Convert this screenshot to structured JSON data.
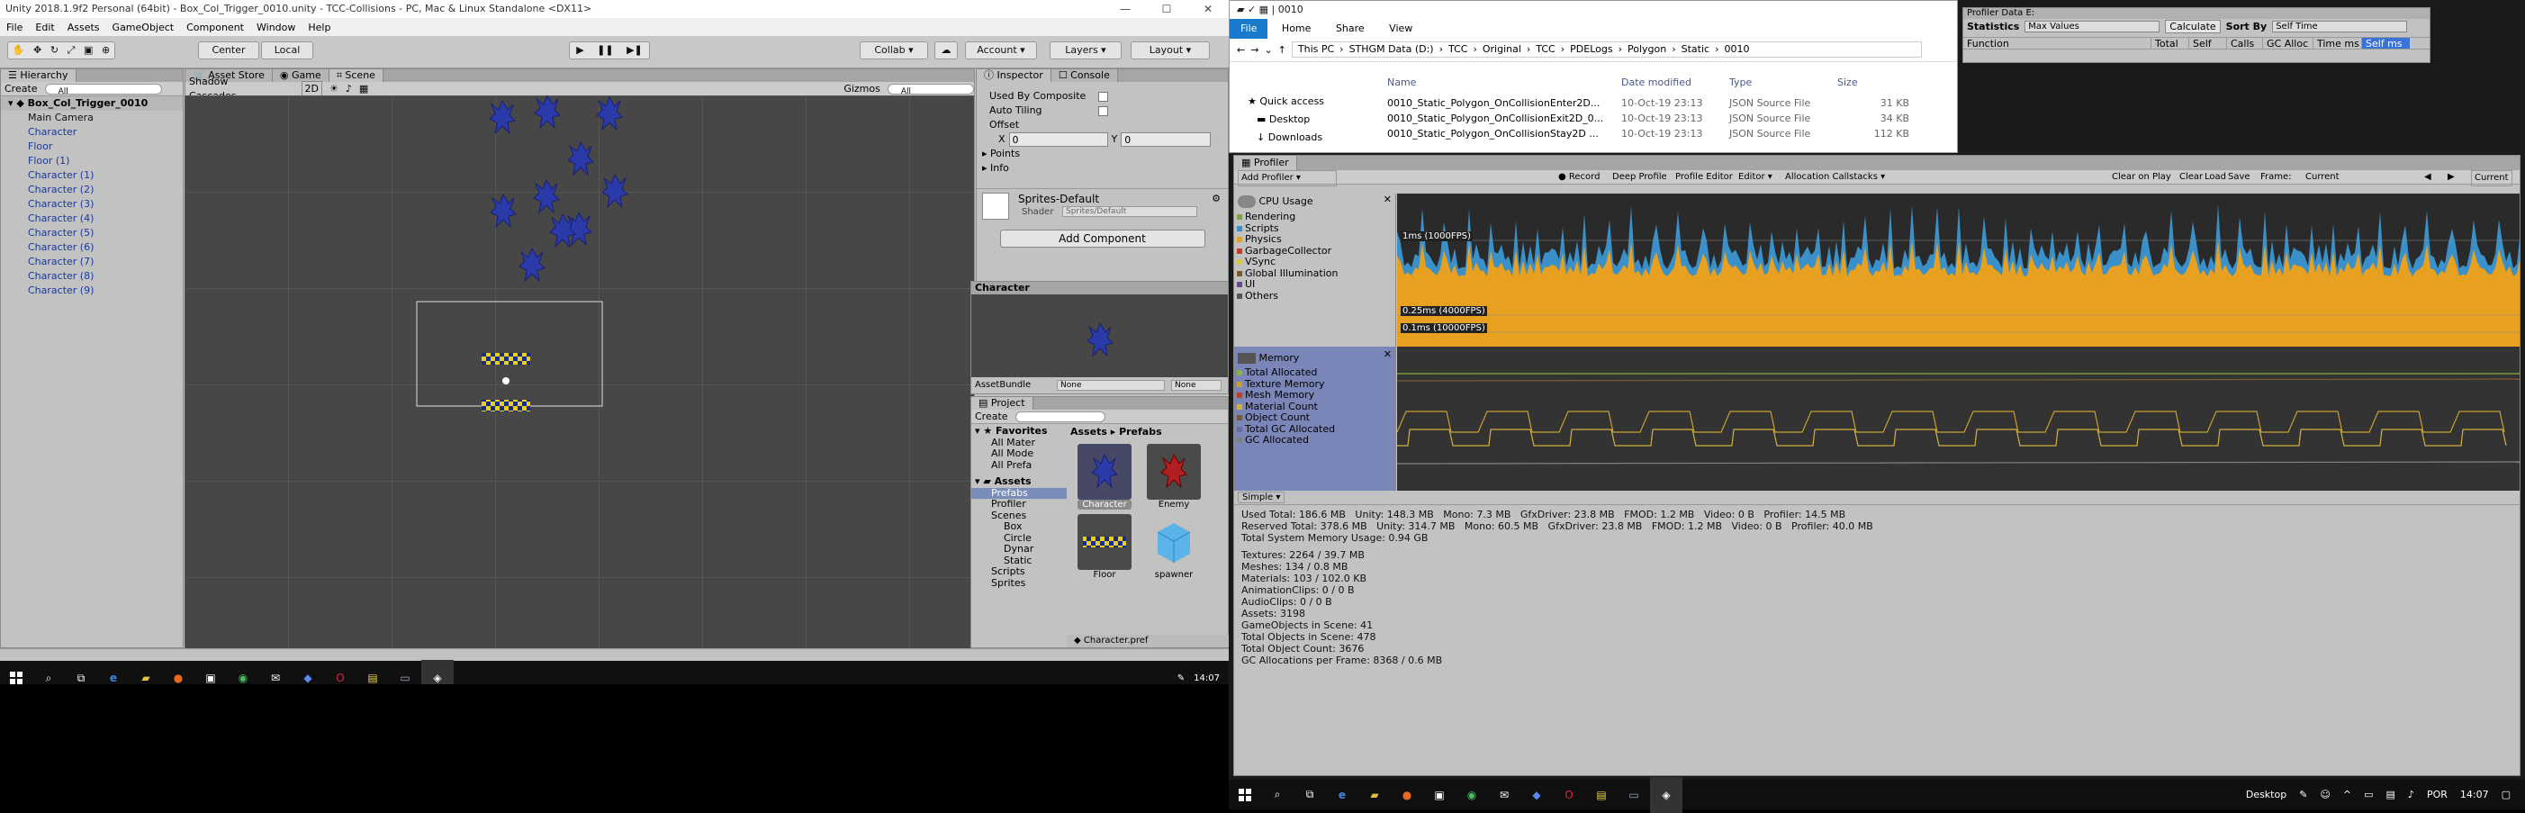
{
  "unity": {
    "title": "Unity 2018.1.9f2 Personal (64bit) - Box_Col_Trigger_0010.unity - TCC-Collisions - PC, Mac & Linux Standalone <DX11>",
    "menu": [
      "File",
      "Edit",
      "Assets",
      "GameObject",
      "Component",
      "Window",
      "Help"
    ],
    "toolbar": {
      "center": "Center",
      "local": "Local",
      "collab": "Collab",
      "account": "Account",
      "layers": "Layers",
      "layout": "Layout"
    },
    "hierarchy": {
      "tab": "Hierarchy",
      "create": "Create",
      "search_placeholder": "All",
      "root": "Box_Col_Trigger_0010",
      "items": [
        "Main Camera",
        "Character",
        "Floor",
        "Floor (1)",
        "Character (1)",
        "Character (2)",
        "Character (3)",
        "Character (4)",
        "Character (5)",
        "Character (6)",
        "Character (7)",
        "Character (8)",
        "Character (9)"
      ]
    },
    "scene": {
      "tabs": [
        "Asset Store",
        "Game",
        "Scene"
      ],
      "shading": "Shadow Cascades",
      "mode2d": "2D",
      "gizmos": "Gizmos",
      "search_placeholder": "All"
    },
    "inspector": {
      "tabs": [
        "Inspector",
        "Console"
      ],
      "used_by_composite": "Used By Composite",
      "auto_tiling": "Auto Tiling",
      "offset": "Offset",
      "x_label": "X",
      "x_val": "0",
      "y_label": "Y",
      "y_val": "0",
      "points": "Points",
      "info": "Info",
      "material": "Sprites-Default",
      "shader_label": "Shader",
      "shader_val": "Sprites/Default",
      "add_component": "Add Component",
      "preview_title": "Character",
      "asset_bundle": "AssetBundle",
      "none1": "None",
      "none2": "None"
    },
    "project": {
      "tab": "Project",
      "create": "Create",
      "favorites": "Favorites",
      "fav_items": [
        "All Mater",
        "All Mode",
        "All Prefa"
      ],
      "assets": "Assets",
      "tree": [
        "Prefabs",
        "Profiler",
        "Scenes",
        "Box",
        "Circle",
        "Dynar",
        "Static",
        "Scripts",
        "Sprites"
      ],
      "breadcrumb": [
        "Assets",
        "Prefabs"
      ],
      "grid": [
        "Character",
        "Enemy",
        "Floor",
        "spawner"
      ],
      "footer": "Character.pref"
    }
  },
  "taskbar_left": {
    "time": "14:07"
  },
  "explorer": {
    "title": "0010",
    "ribbon": [
      "File",
      "Home",
      "Share",
      "View"
    ],
    "path": [
      "This PC",
      "STHGM Data (D:)",
      "TCC",
      "Original",
      "TCC",
      "PDELogs",
      "Polygon",
      "Static",
      "0010"
    ],
    "nav": [
      "Quick access",
      "Desktop",
      "Downloads"
    ],
    "cols": [
      "Name",
      "Date modified",
      "Type",
      "Size"
    ],
    "files": [
      {
        "name": "0010_Static_Polygon_OnCollisionEnter2D...",
        "date": "10-Oct-19 23:13",
        "type": "JSON Source File",
        "size": "31 KB"
      },
      {
        "name": "0010_Static_Polygon_OnCollisionExit2D_0...",
        "date": "10-Oct-19 23:13",
        "type": "JSON Source File",
        "size": "34 KB"
      },
      {
        "name": "0010_Static_Polygon_OnCollisionStay2D ...",
        "date": "10-Oct-19 23:13",
        "type": "JSON Source File",
        "size": "112 KB"
      }
    ]
  },
  "profdata": {
    "title": "Profiler Data E:",
    "statistics": "Statistics",
    "max_values": "Max Values",
    "calculate": "Calculate",
    "sort_by": "Sort By",
    "self_time": "Self Time",
    "cols": [
      "Function",
      "Total",
      "Self",
      "Calls",
      "GC Alloc",
      "Time ms",
      "Self ms"
    ]
  },
  "profiler": {
    "tab": "Profiler",
    "add_profiler": "Add Profiler",
    "toolbar": [
      "Record",
      "Deep Profile",
      "Profile Editor",
      "Editor",
      "Allocation Callstacks"
    ],
    "toolbar_right": [
      "Clear on Play",
      "Clear",
      "Load",
      "Save",
      "Frame:",
      "Current",
      "Current"
    ],
    "cpu_title": "CPU Usage",
    "cpu_legend": [
      {
        "name": "Rendering",
        "color": "#7fa342"
      },
      {
        "name": "Scripts",
        "color": "#3a90c8"
      },
      {
        "name": "Physics",
        "color": "#e8a020"
      },
      {
        "name": "GarbageCollector",
        "color": "#c0402a"
      },
      {
        "name": "VSync",
        "color": "#d8c63c"
      },
      {
        "name": "Global Illumination",
        "color": "#7a5a2a"
      },
      {
        "name": "UI",
        "color": "#6a4a8a"
      },
      {
        "name": "Others",
        "color": "#555555"
      }
    ],
    "labels": {
      "ms1": "1ms (1000FPS)",
      "ms025": "0.25ms (4000FPS)",
      "ms01": "0.1ms (10000FPS)"
    },
    "mem_title": "Memory",
    "mem_legend": [
      {
        "name": "Total Allocated",
        "color": "#8bb040"
      },
      {
        "name": "Texture Memory",
        "color": "#c8a030"
      },
      {
        "name": "Mesh Memory",
        "color": "#c04020"
      },
      {
        "name": "Material Count",
        "color": "#d2b040"
      },
      {
        "name": "Object Count",
        "color": "#7a5a30"
      },
      {
        "name": "Total GC Allocated",
        "color": "#6a6aa0"
      },
      {
        "name": "GC Allocated",
        "color": "#808080"
      }
    ],
    "simple": "Simple",
    "stats1": "Used Total: 186.6 MB   Unity: 148.3 MB   Mono: 7.3 MB   GfxDriver: 23.8 MB   FMOD: 1.2 MB   Video: 0 B   Profiler: 14.5 MB\nReserved Total: 378.6 MB   Unity: 314.7 MB   Mono: 60.5 MB   GfxDriver: 23.8 MB   FMOD: 1.2 MB   Video: 0 B   Profiler: 40.0 MB\nTotal System Memory Usage: 0.94 GB",
    "stats2": "Textures: 2264 / 39.7 MB\nMeshes: 134 / 0.8 MB\nMaterials: 103 / 102.0 KB\nAnimationClips: 0 / 0 B\nAudioClips: 0 / 0 B\nAssets: 3198\nGameObjects in Scene: 41\nTotal Objects in Scene: 478\nTotal Object Count: 3676\nGC Allocations per Frame: 8368 / 0.6 MB"
  },
  "taskbar_right": {
    "desktop": "Desktop",
    "lang": "POR",
    "time": "14:07"
  }
}
